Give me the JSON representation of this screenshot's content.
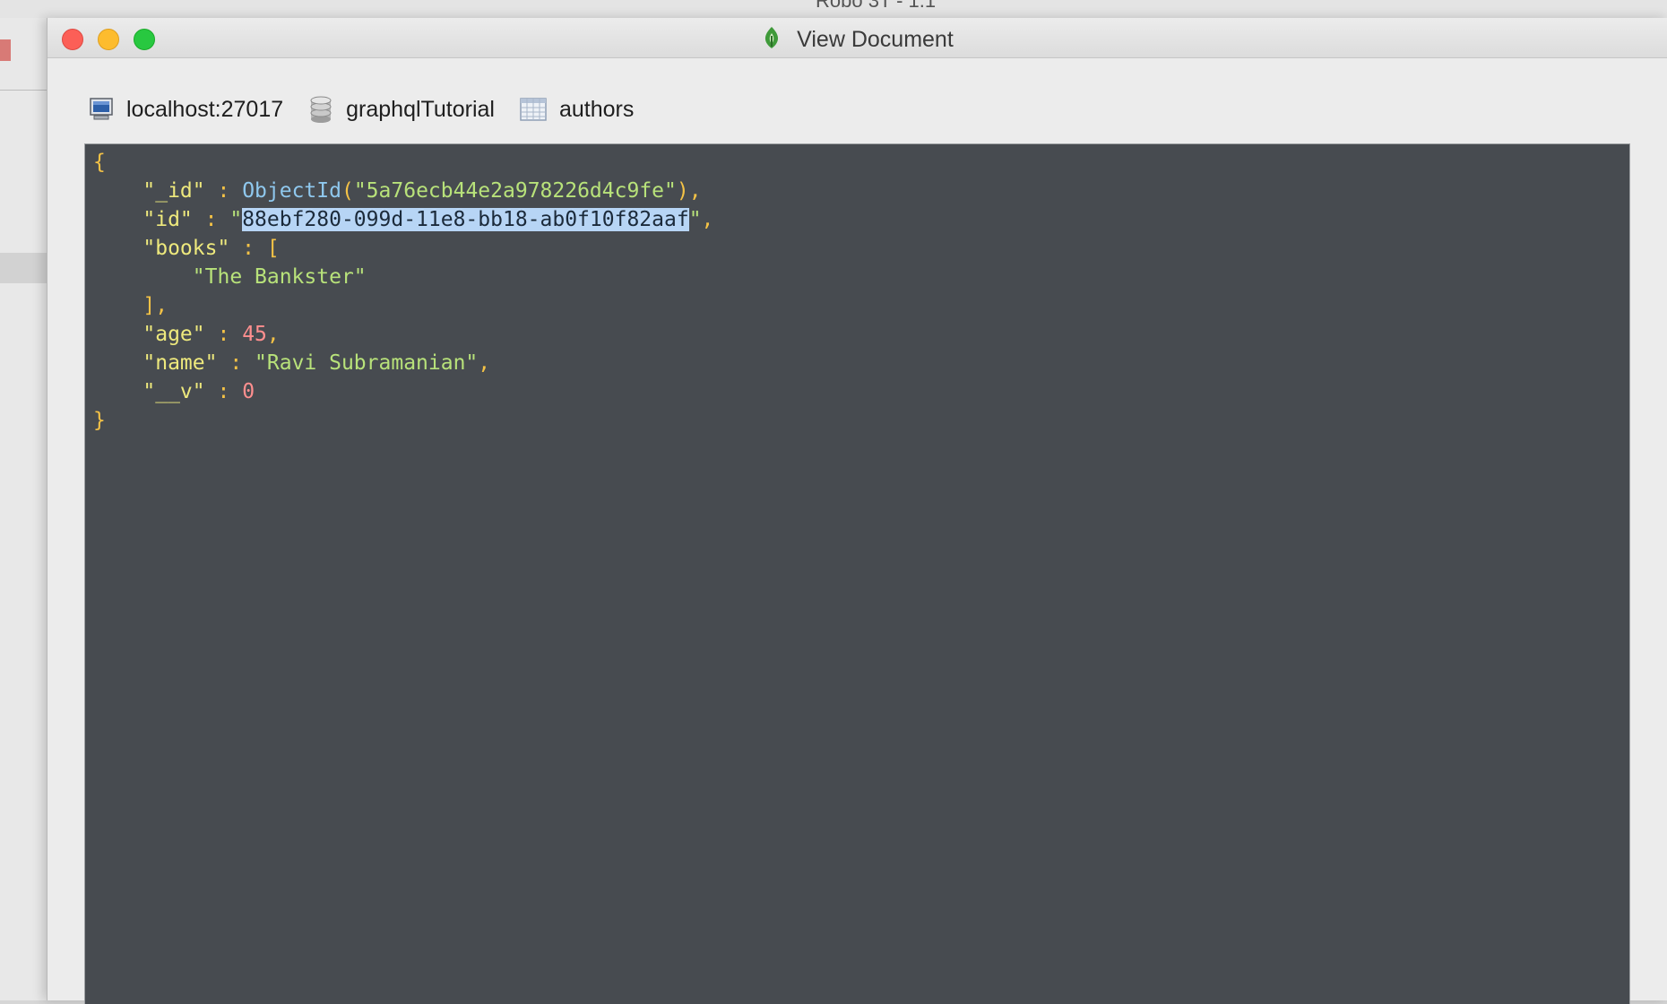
{
  "background_app": {
    "title": "Robo 3T - 1.1"
  },
  "window": {
    "title": "View Document"
  },
  "breadcrumb": {
    "host": "localhost:27017",
    "database": "graphqlTutorial",
    "collection": "authors"
  },
  "document": {
    "open_brace": "{",
    "close_brace": "}",
    "_id": {
      "key": "\"_id\"",
      "func": "ObjectId",
      "value": "\"5a76ecb44e2a978226d4c9fe\""
    },
    "id": {
      "key": "\"id\"",
      "value": "88ebf280-099d-11e8-bb18-ab0f10f82aaf"
    },
    "books": {
      "key": "\"books\"",
      "items": [
        "\"The Bankster\""
      ]
    },
    "age": {
      "key": "\"age\"",
      "value": "45"
    },
    "name": {
      "key": "\"name\"",
      "value": "\"Ravi Subramanian\""
    },
    "__v": {
      "key": "\"__v\"",
      "value": "0"
    }
  },
  "colors": {
    "editor_bg": "#474b50",
    "brace": "#f4c246",
    "key": "#eee97d",
    "string": "#b8e27a",
    "number": "#ff8f8f",
    "function": "#8fc8ee",
    "selection": "#b7d5f5"
  },
  "icons": [
    "computer-icon",
    "database-icon",
    "collection-table-icon",
    "robo3t-leaf-icon"
  ]
}
